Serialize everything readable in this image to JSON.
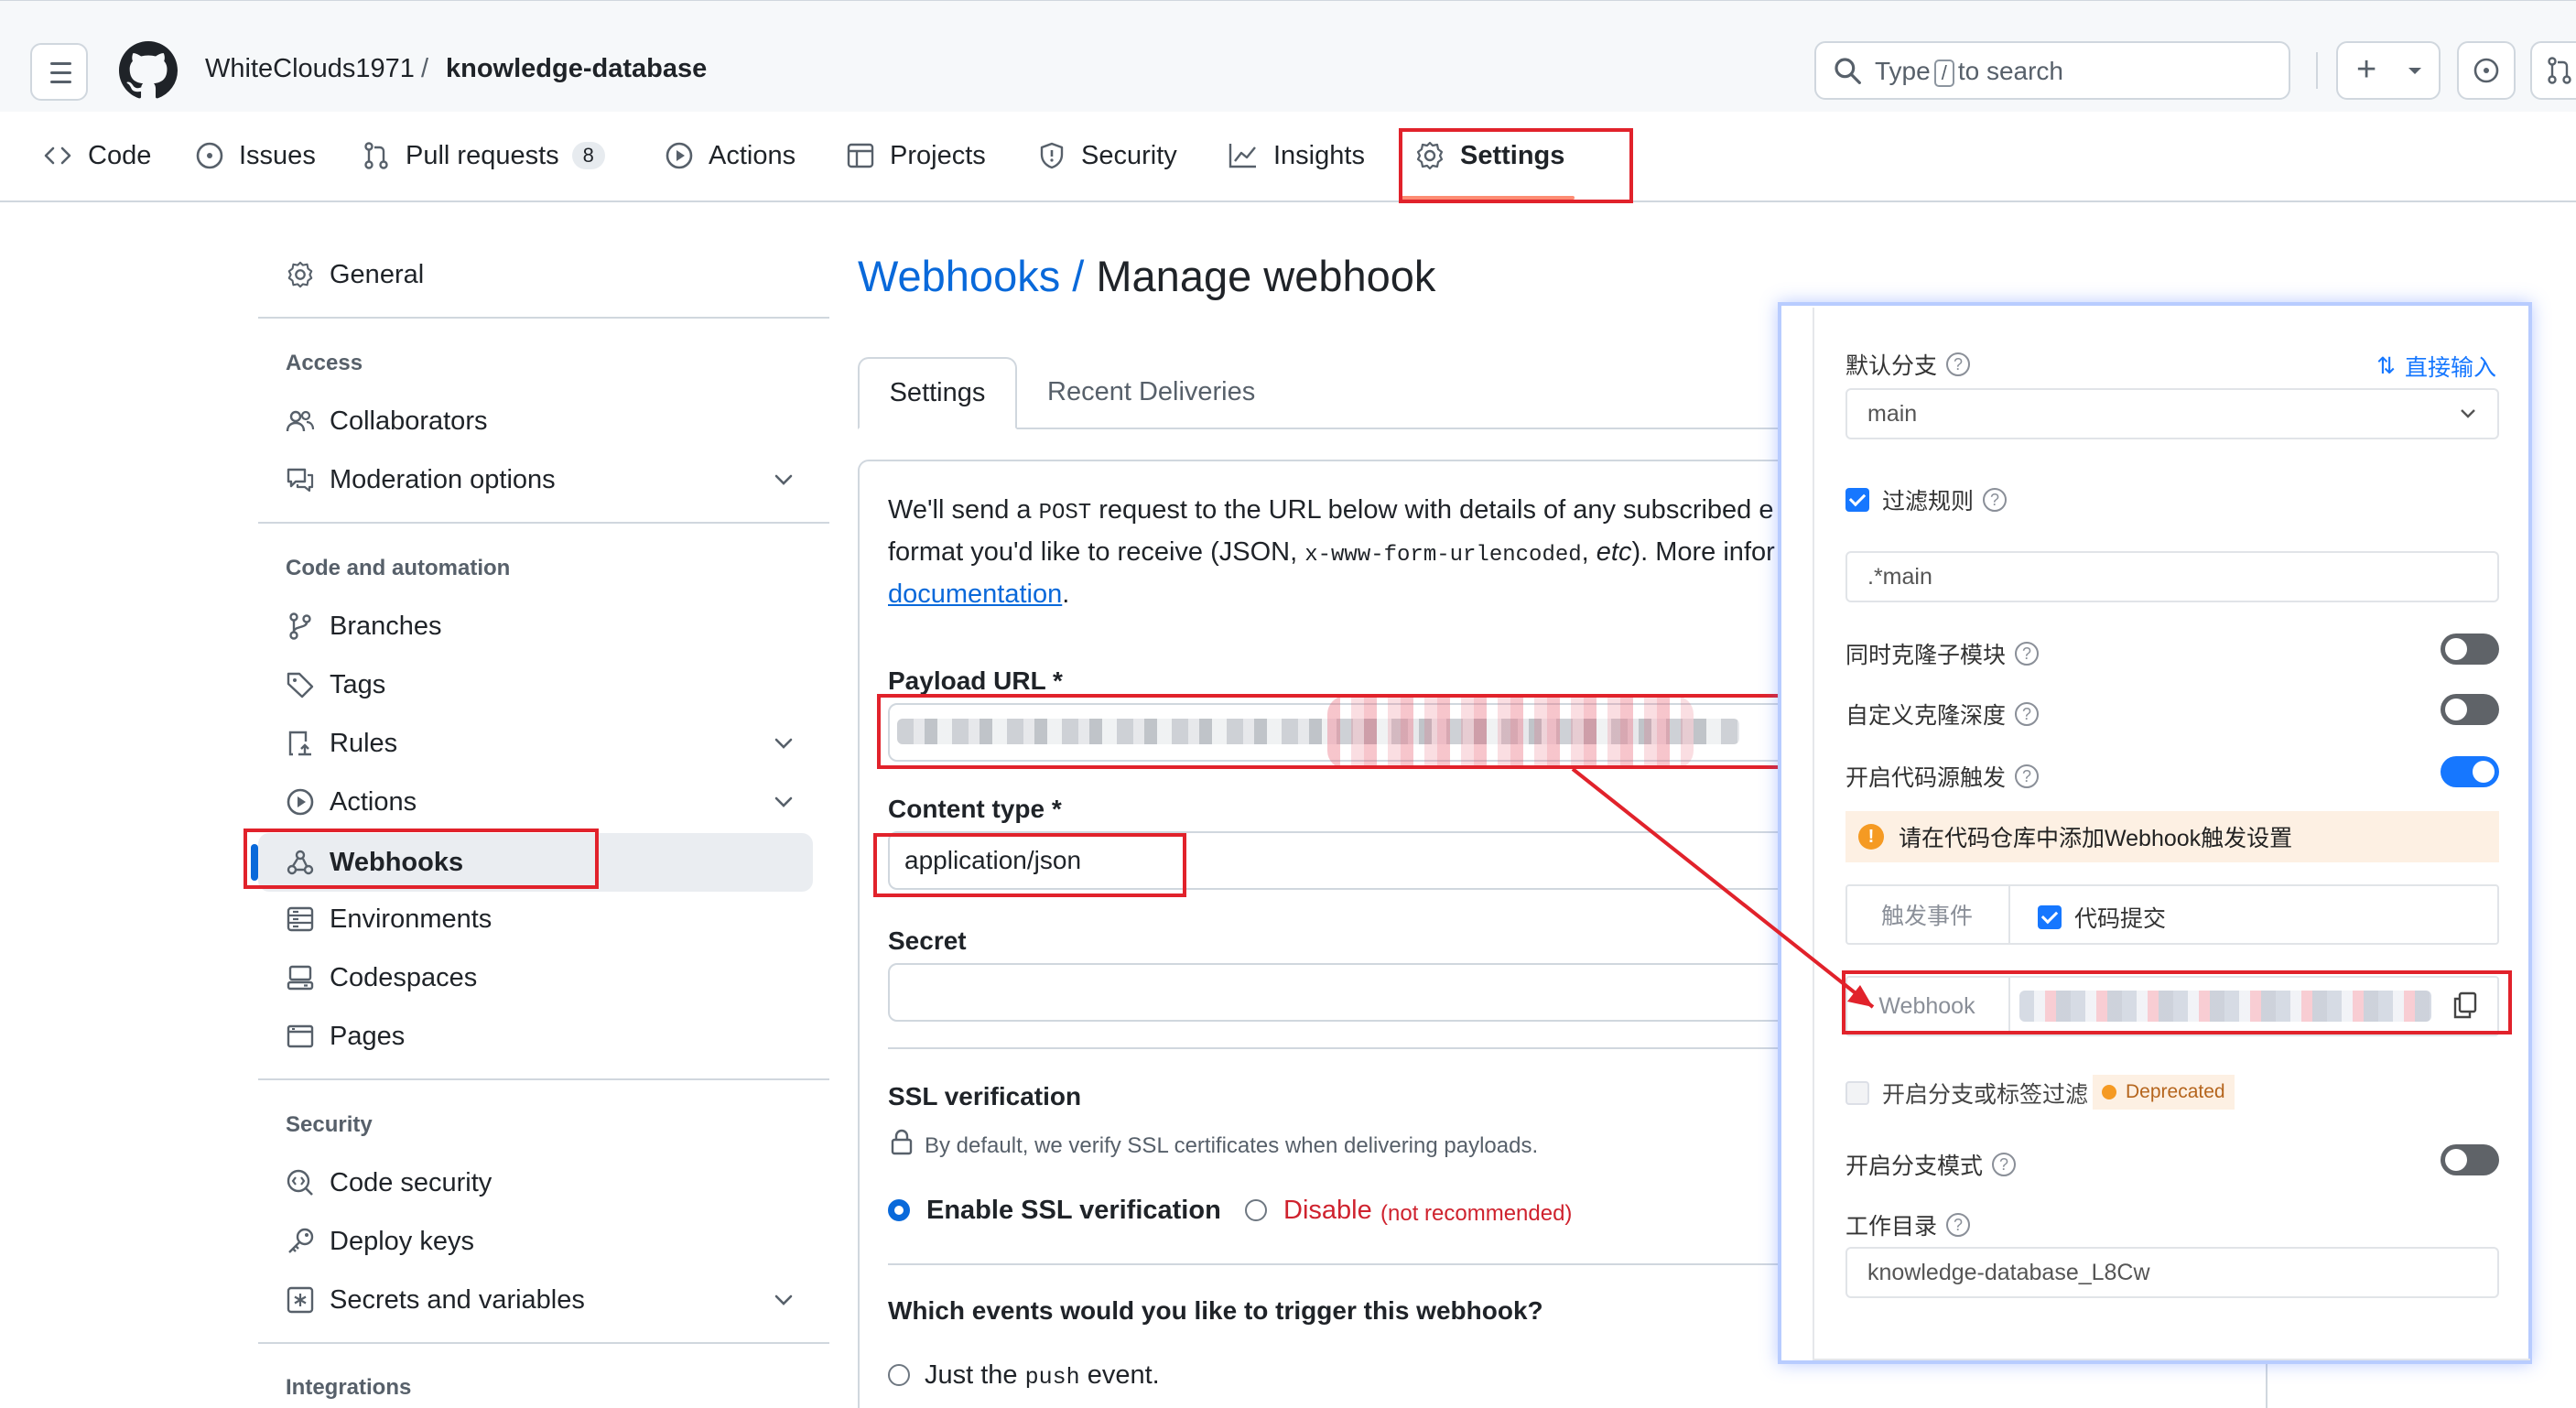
{
  "header": {
    "owner": "WhiteClouds1971",
    "separator": "/",
    "repo": "knowledge-database",
    "search_prefix": "Type",
    "search_key": "/",
    "search_suffix": "to search",
    "plus_label": "+"
  },
  "nav": {
    "code": "Code",
    "issues": "Issues",
    "pulls": "Pull requests",
    "pulls_count": "8",
    "actions": "Actions",
    "projects": "Projects",
    "security": "Security",
    "insights": "Insights",
    "settings": "Settings"
  },
  "sidebar": {
    "general": "General",
    "access_head": "Access",
    "collaborators": "Collaborators",
    "moderation": "Moderation options",
    "code_head": "Code and automation",
    "branches": "Branches",
    "tags": "Tags",
    "rules": "Rules",
    "actions": "Actions",
    "webhooks": "Webhooks",
    "environments": "Environments",
    "codespaces": "Codespaces",
    "pages": "Pages",
    "security_head": "Security",
    "code_security": "Code security",
    "deploy_keys": "Deploy keys",
    "secrets": "Secrets and variables",
    "integrations_head": "Integrations"
  },
  "main": {
    "crumb": "Webhooks /",
    "title": "Manage webhook",
    "tab_settings": "Settings",
    "tab_deliveries": "Recent Deliveries",
    "intro_1": "We'll send a",
    "intro_post": "POST",
    "intro_2": "request to the URL below with details of any subscribed e",
    "intro_3": "format you'd like to receive (JSON,",
    "intro_form": "x-www-form-urlencoded",
    "intro_4": ",",
    "intro_etc": "etc",
    "intro_5": "). More infor",
    "intro_link": "documentation",
    "intro_end": ".",
    "payload_label": "Payload URL *",
    "content_type_label": "Content type *",
    "content_type_value": "application/json",
    "secret_label": "Secret",
    "ssl_label": "SSL verification",
    "ssl_desc": "By default, we verify SSL certificates when delivering payloads.",
    "ssl_enable": "Enable SSL verification",
    "ssl_disable": "Disable",
    "ssl_not_rec": "(not recommended)",
    "events_label": "Which events would you like to trigger this webhook?",
    "just_push_1": "Just the",
    "just_push_code": "push",
    "just_push_2": "event."
  },
  "overlay": {
    "default_branch": "默认分支",
    "direct_input": "直接输入",
    "branch_value": "main",
    "filter_rules": "过滤规则",
    "filter_value": ".*main",
    "clone_submodules": "同时克隆子模块",
    "clone_depth": "自定义克隆深度",
    "source_trigger": "开启代码源触发",
    "warning": "请在代码仓库中添加Webhook触发设置",
    "trigger_event": "触发事件",
    "code_commit": "代码提交",
    "webhook_label": "Webhook",
    "branch_tag_filter": "开启分支或标签过滤",
    "deprecated": "Deprecated",
    "branch_mode": "开启分支模式",
    "work_dir": "工作目录",
    "work_dir_value": "knowledge-database_L8Cw",
    "toggles": {
      "clone_submodules": false,
      "clone_depth": false,
      "source_trigger": true,
      "branch_mode": false
    }
  },
  "colors": {
    "accent": "#0969da",
    "highlight": "#e1222b",
    "toggle_on": "#1677ff",
    "danger": "#cf222e"
  }
}
